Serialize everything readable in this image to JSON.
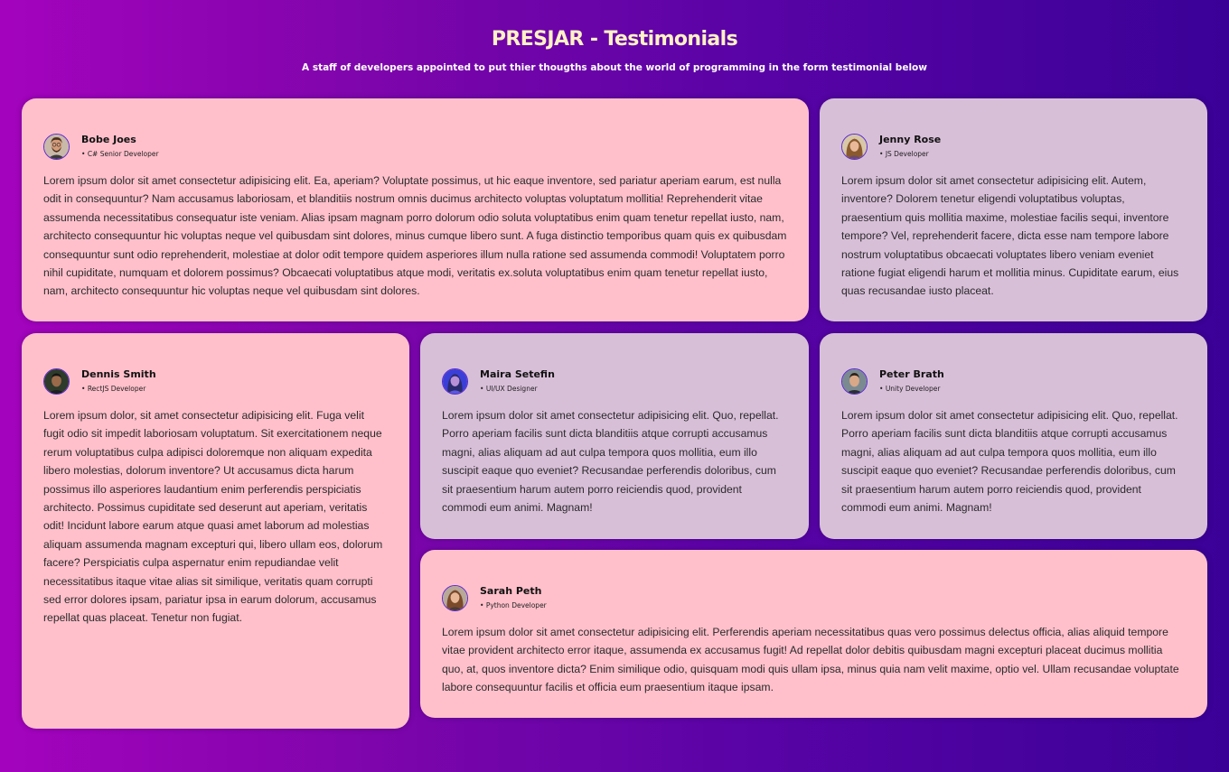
{
  "page": {
    "title": "PRESJAR - Testimonials",
    "subtitle": "A staff of developers appointed to put thier thougths about the world of programming in the form testimonial below"
  },
  "colors": {
    "card_pink": "#ffc0cb",
    "card_lilac": "#d8bfd8",
    "title": "#fff2c4",
    "avatar_border": "#5a2bd0"
  },
  "testimonials": [
    {
      "name": "Bobe Joes",
      "role": "C# Senior Developer",
      "avatar_icon": "avatar-man-beard-glasses-icon",
      "text": "Lorem ipsum dolor sit amet consectetur adipisicing elit. Ea, aperiam? Voluptate possimus, ut hic eaque inventore, sed pariatur aperiam earum, est nulla odit in consequuntur? Nam accusamus laboriosam, et blanditiis nostrum omnis ducimus architecto voluptas voluptatum mollitia! Reprehenderit vitae assumenda necessitatibus consequatur iste veniam. Alias ipsam magnam porro dolorum odio soluta voluptatibus enim quam tenetur repellat iusto, nam, architecto consequuntur hic voluptas neque vel quibusdam sint dolores, minus cumque libero sunt. A fuga distinctio temporibus quam quis ex quibusdam consequuntur sunt odio reprehenderit, molestiae at dolor odit tempore quidem asperiores illum nulla ratione sed assumenda commodi! Voluptatem porro nihil cupiditate, numquam et dolorem possimus? Obcaecati voluptatibus atque modi, veritatis ex.soluta voluptatibus enim quam tenetur repellat iusto, nam, architecto consequuntur hic voluptas neque vel quibusdam sint dolores."
    },
    {
      "name": "Jenny Rose",
      "role": "JS Developer",
      "avatar_icon": "avatar-woman-icon",
      "text": "Lorem ipsum dolor sit amet consectetur adipisicing elit. Autem, inventore? Dolorem tenetur eligendi voluptatibus voluptas, praesentium quis mollitia maxime, molestiae facilis sequi, inventore tempore? Vel, reprehenderit facere, dicta esse nam tempore labore nostrum voluptatibus obcaecati voluptates libero veniam eveniet ratione fugiat eligendi harum et mollitia minus. Cupiditate earum, eius quas recusandae iusto placeat."
    },
    {
      "name": "Dennis Smith",
      "role": "RectJS Developer",
      "avatar_icon": "avatar-man-icon",
      "text": "Lorem ipsum dolor, sit amet consectetur adipisicing elit. Fuga velit fugit odio sit impedit laboriosam voluptatum. Sit exercitationem neque rerum voluptatibus culpa adipisci doloremque non aliquam expedita libero molestias, dolorum inventore? Ut accusamus dicta harum possimus illo asperiores laudantium enim perferendis perspiciatis architecto. Possimus cupiditate sed deserunt aut aperiam, veritatis odit! Incidunt labore earum atque quasi amet laborum ad molestias aliquam assumenda magnam excepturi qui, libero ullam eos, dolorum facere? Perspiciatis culpa aspernatur enim repudiandae velit necessitatibus itaque vitae alias sit similique, veritatis quam corrupti sed error dolores ipsam, pariatur ipsa in earum dolorum, accusamus repellat quas placeat. Tenetur non fugiat."
    },
    {
      "name": "Maira Setefin",
      "role": "UI/UX Designer",
      "avatar_icon": "avatar-woman-icon",
      "text": "Lorem ipsum dolor sit amet consectetur adipisicing elit. Quo, repellat. Porro aperiam facilis sunt dicta blanditiis atque corrupti accusamus magni, alias aliquam ad aut culpa tempora quos mollitia, eum illo suscipit eaque quo eveniet? Recusandae perferendis doloribus, cum sit praesentium harum autem porro reiciendis quod, provident commodi eum animi. Magnam!"
    },
    {
      "name": "Peter Brath",
      "role": "Unity Developer",
      "avatar_icon": "avatar-man-icon",
      "text": "Lorem ipsum dolor sit amet consectetur adipisicing elit. Quo, repellat. Porro aperiam facilis sunt dicta blanditiis atque corrupti accusamus magni, alias aliquam ad aut culpa tempora quos mollitia, eum illo suscipit eaque quo eveniet? Recusandae perferendis doloribus, cum sit praesentium harum autem porro reiciendis quod, provident commodi eum animi. Magnam!"
    },
    {
      "name": "Sarah Peth",
      "role": "Python Developer",
      "avatar_icon": "avatar-woman-icon",
      "text": "Lorem ipsum dolor sit amet consectetur adipisicing elit. Perferendis aperiam necessitatibus quas vero possimus delectus officia, alias aliquid tempore vitae provident architecto error itaque, assumenda ex accusamus fugit! Ad repellat dolor debitis quibusdam magni excepturi placeat ducimus mollitia quo, at, quos inventore dicta? Enim similique odio, quisquam modi quis ullam ipsa, minus quia nam velit maxime, optio vel. Ullam recusandae voluptate labore consequuntur facilis et officia eum praesentium itaque ipsam."
    }
  ]
}
